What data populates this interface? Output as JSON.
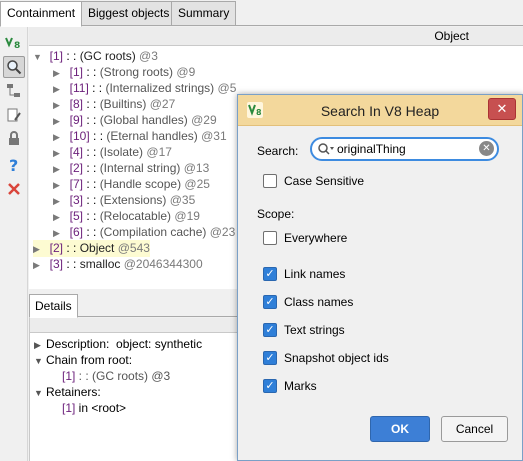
{
  "tabs": [
    "Containment",
    "Biggest objects",
    "Summary"
  ],
  "tree": {
    "column_header": "Object",
    "rows": [
      {
        "expanded": true,
        "index": "[1]",
        "sep": " : : ",
        "name": "(GC roots)",
        "id": "@3"
      },
      {
        "expanded": false,
        "index": "[1]",
        "sep": " : : ",
        "name": "(Strong roots)",
        "id": "@9"
      },
      {
        "expanded": false,
        "index": "[11]",
        "sep": " : : ",
        "name": "(Internalized strings)",
        "id": "@5"
      },
      {
        "expanded": false,
        "index": "[8]",
        "sep": " : : ",
        "name": "(Builtins)",
        "id": "@27"
      },
      {
        "expanded": false,
        "index": "[9]",
        "sep": " : : ",
        "name": "(Global handles)",
        "id": "@29"
      },
      {
        "expanded": false,
        "index": "[10]",
        "sep": " : : ",
        "name": "(Eternal handles)",
        "id": "@31"
      },
      {
        "expanded": false,
        "index": "[4]",
        "sep": " : : ",
        "name": "(Isolate)",
        "id": "@17"
      },
      {
        "expanded": false,
        "index": "[2]",
        "sep": " : : ",
        "name": "(Internal string)",
        "id": "@13"
      },
      {
        "expanded": false,
        "index": "[7]",
        "sep": " : : ",
        "name": "(Handle scope)",
        "id": "@25"
      },
      {
        "expanded": false,
        "index": "[3]",
        "sep": " : : ",
        "name": "(Extensions)",
        "id": "@35"
      },
      {
        "expanded": false,
        "index": "[5]",
        "sep": " : : ",
        "name": "(Relocatable)",
        "id": "@19"
      },
      {
        "expanded": false,
        "index": "[6]",
        "sep": " : : ",
        "name": "(Compilation cache)",
        "id": "@23"
      },
      {
        "expanded": false,
        "index": "[2]",
        "sep": " : : ",
        "name": "Object",
        "id": "@543"
      },
      {
        "expanded": false,
        "index": "[3]",
        "sep": " : : ",
        "name": "smalloc",
        "id": "@2046344300"
      }
    ]
  },
  "details": {
    "tab": "Details",
    "description_label": "Description:",
    "description_value": "object: synthetic",
    "chain_label": "Chain from root:",
    "chain_item_index": "[1]",
    "chain_item_rest": " : : (GC roots) @3",
    "retainers_label": "Retainers:",
    "retainer_index": "[1]",
    "retainer_rest": " in <root>"
  },
  "dialog": {
    "title": "Search In V8 Heap",
    "search_label": "Search:",
    "search_value": "originalThing",
    "case_sensitive": {
      "label": "Case Sensitive",
      "checked": false
    },
    "scope_label": "Scope:",
    "everywhere": {
      "label": "Everywhere",
      "checked": false
    },
    "options": [
      {
        "label": "Link names",
        "checked": true
      },
      {
        "label": "Class names",
        "checked": true
      },
      {
        "label": "Text strings",
        "checked": true
      },
      {
        "label": "Snapshot object ids",
        "checked": true
      },
      {
        "label": "Marks",
        "checked": true
      }
    ],
    "ok_label": "OK",
    "cancel_label": "Cancel",
    "close_label": "✕"
  },
  "icons": [
    "v8-heap-icon",
    "search-icon",
    "hierarchy-icon",
    "edit-icon",
    "lock-icon",
    "help-icon",
    "close-icon"
  ]
}
